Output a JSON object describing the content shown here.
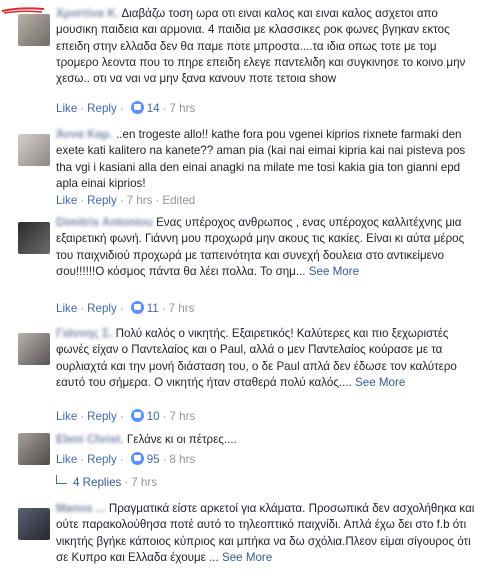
{
  "comments": [
    {
      "author": "Χριστίνα Κ.",
      "text": "Διαβάζω τοση ωρα οτι ειναι καλος και ειναι καλος ασχετοι απο μουσικη παιδεια και αρμονια. 4 παιδια με κλασσικες ροκ φωνες βγηκαν εκτος επειδη στην ελλαδα δεν θα παμε ποτε μπροστα....τα ιδια οπως τοτε με τομ τρομερο λεοντα που το πηρε επειδη ελεγε παντελιδη και συγκινησε το κοινο μην χεσω.. οτι να ναι να μην ξανα κανουν ποτε τετοια show",
      "like": "Like",
      "reply": "Reply",
      "reactions": "14",
      "time": "7 hrs",
      "edited": "",
      "see_more": ""
    },
    {
      "author": "Άννα Καρ.",
      "text": "..en trogeste allo!! kathe fora pou vgenei kiprios rixnete farmaki den exete kati kalitero na kanete?? aman pia (kai nai eimai kipria kai nai pisteva pos tha vgi i kasiani alla den einai anagki na milate me tosi kakia gia ton gianni epd apla einai kiprios!",
      "like": "Like",
      "reply": "Reply",
      "reactions": "",
      "time": "7 hrs",
      "edited": "Edited",
      "see_more": ""
    },
    {
      "author": "Dimitris Antoniou",
      "text": "Ενας υπέροχος ανθρωπος , ενας υπέροχος καλλιτέχνης μια εξαιρετική φωνή. Γιάννη μου προχωρά μην ακους τις κακίες. Είναι κι αύτα μέρος του παιχνιδιού προχωρά με ταπεινότητα και συνεχή δουλεια στο αντικείμενο σου!!!!!!Ο κόσμος πάντα θα λέει πολλα. Το σημ...",
      "like": "Like",
      "reply": "Reply",
      "reactions": "11",
      "time": "7 hrs",
      "edited": "",
      "see_more": "See More"
    },
    {
      "author": "Γιάννης Σ.",
      "text": "Πολύ καλός ο νικητής. Εξαιρετικός! Καλύτερες και πιο ξεχωριστές φωνές είχαν ο Παντελαίος και ο Paul, αλλά ο μεν Παντελαίος κούρασε με τα ουρλιαχτά και την μονή διάσταση του, ο δε Paul απλά δεν έδωσε τον καλύτερο εαυτό του σήμερα. Ο νικητής ήταν σταθερά πολύ καλός....",
      "like": "Like",
      "reply": "Reply",
      "reactions": "10",
      "time": "7 hrs",
      "edited": "",
      "see_more": "See More"
    },
    {
      "author": "Eleni Christ.",
      "text": "Γελάνε κι οι πέτρες....",
      "like": "Like",
      "reply": "Reply",
      "reactions": "95",
      "time": "8 hrs",
      "edited": "",
      "see_more": ""
    },
    {
      "author": "Manos ...",
      "text": "Πραγματικά είστε αρκετοί για κλάματα. Προσωπικά δεν ασχολήθηκα και ούτε παρακολούθησα ποτέ αυτό το τηλεοπτικό παιχνίδι. Απλά έχω δει στο f.b ότι νικητής βγήκε κάποιος κύπριος και μπήκα να δω σχόλια.Πλεον είμαι σίγουρος ότι σε Κυπρο και Ελλαδα έχουμε ...",
      "like": "",
      "reply": "",
      "reactions": "",
      "time": "",
      "edited": "",
      "see_more": "See More"
    }
  ],
  "replies_link": "4 Replies",
  "replies_time": "7 hrs",
  "colors": {
    "link": "#365899",
    "meta": "#90949c",
    "text": "#1d2129",
    "reaction": "#5890ff",
    "mark": "#e0282e"
  }
}
